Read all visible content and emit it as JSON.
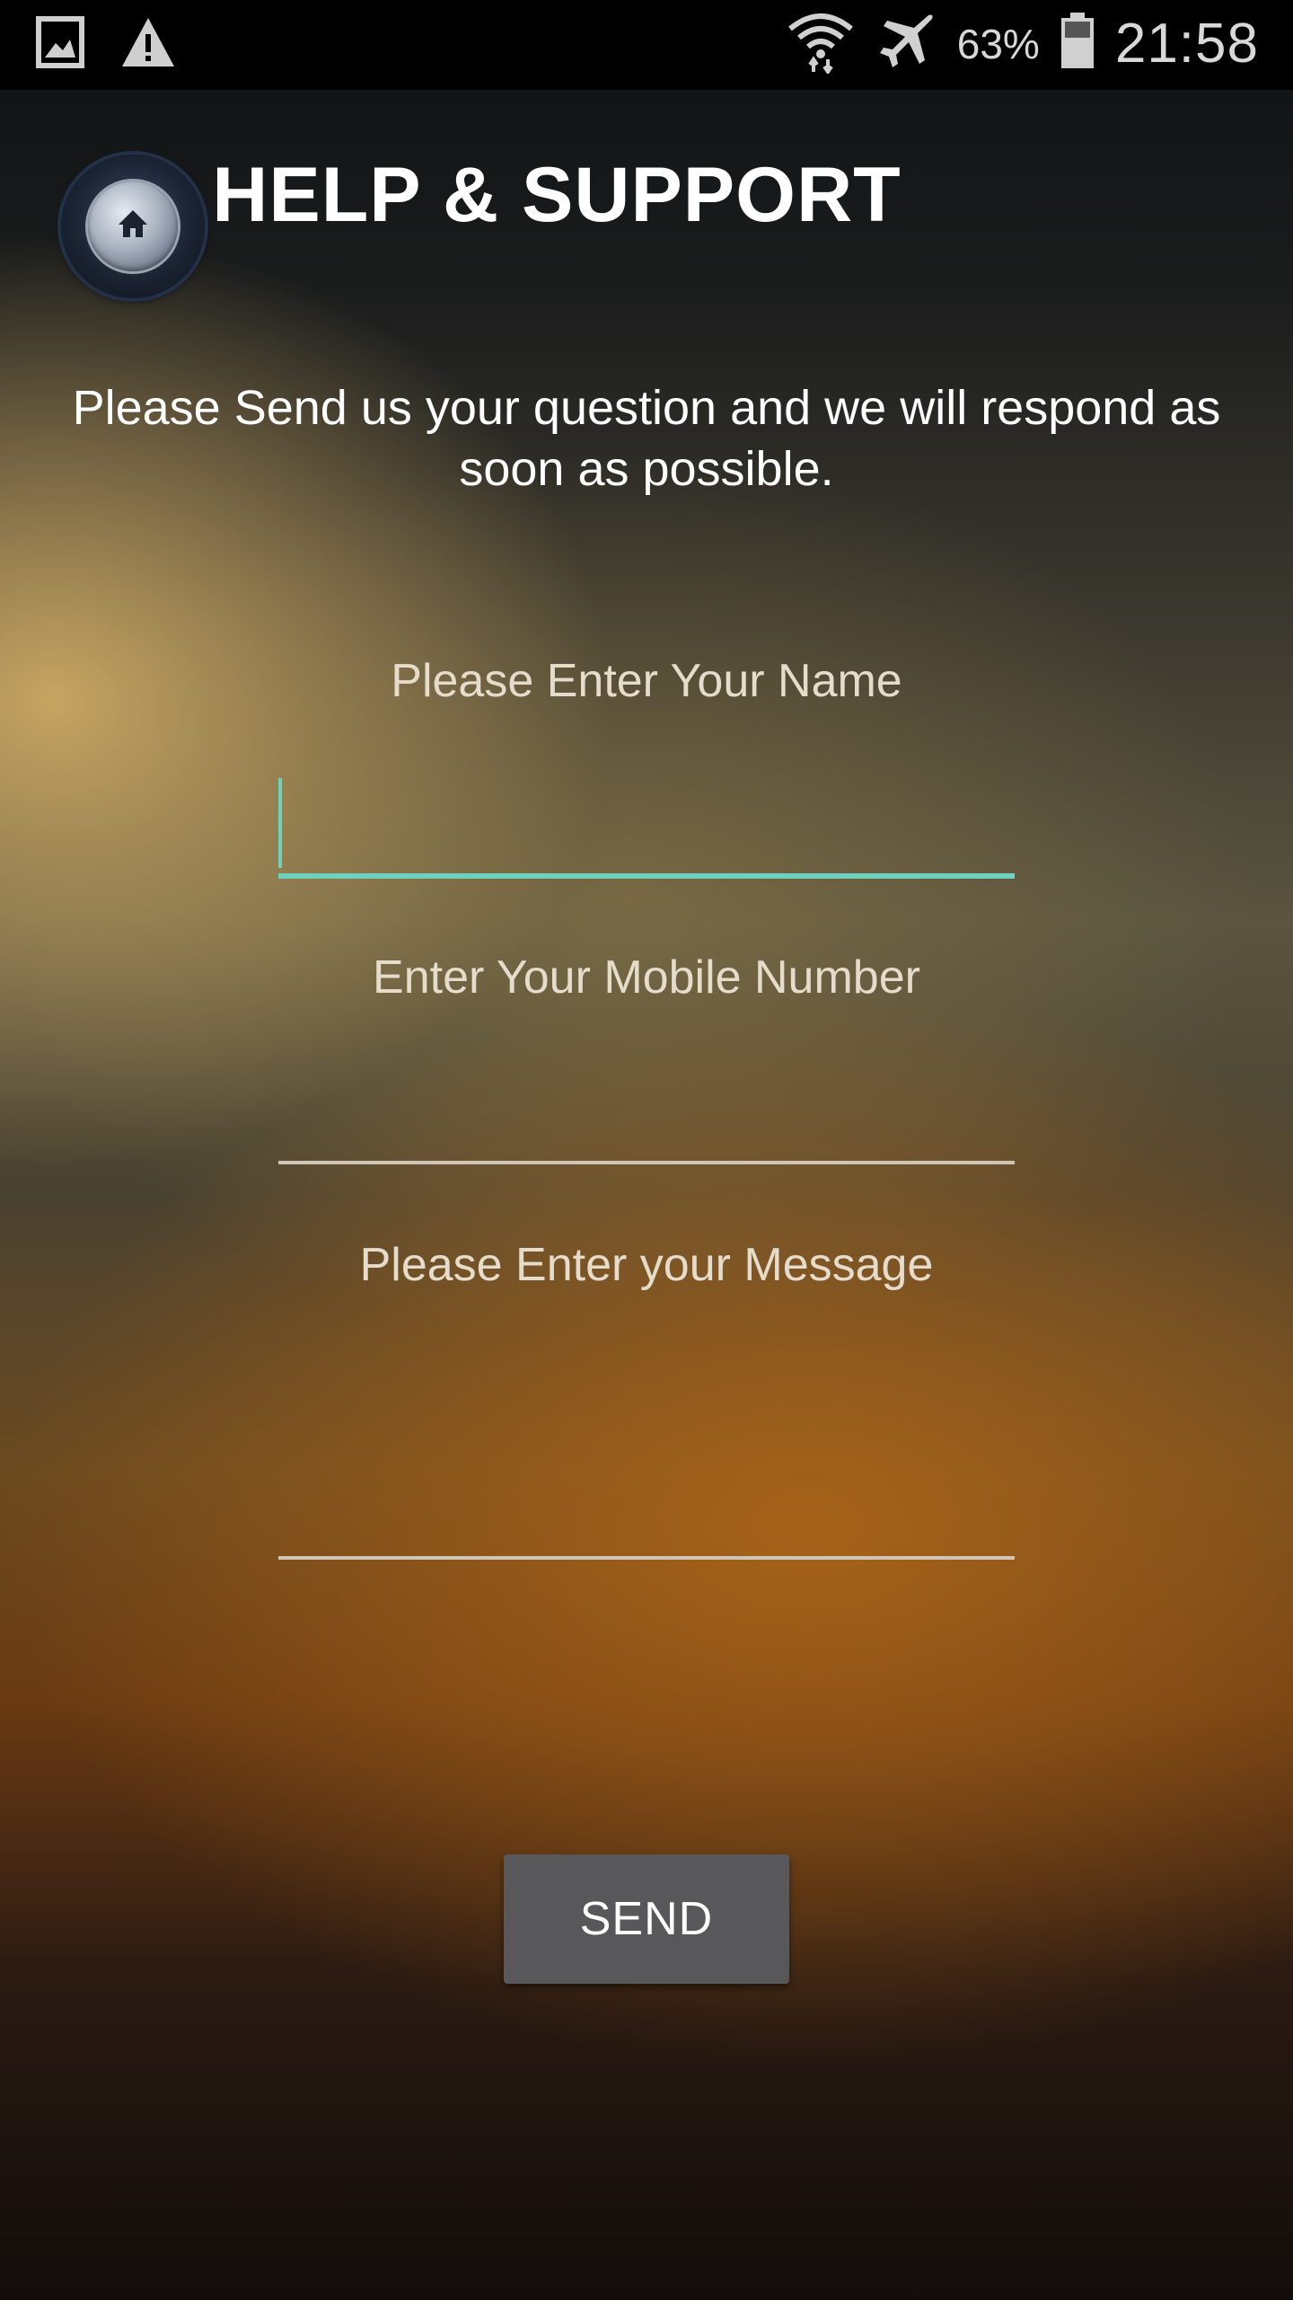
{
  "status_bar": {
    "left_icons": [
      "gallery-icon",
      "warning-icon"
    ],
    "right_icons": [
      "wifi-icon",
      "airplane-mode-icon",
      "battery-icon"
    ],
    "battery_percent": "63%",
    "time": "21:58"
  },
  "header": {
    "home_icon": "home-icon",
    "title": "HELP & SUPPORT"
  },
  "intro": {
    "text": "Please Send us your question and we will respond as soon as possible."
  },
  "form": {
    "name": {
      "label": "Please Enter Your Name",
      "value": ""
    },
    "mobile": {
      "label": "Enter Your Mobile Number",
      "value": ""
    },
    "message": {
      "label": "Please Enter your Message",
      "value": ""
    },
    "send_label": "SEND"
  },
  "colors": {
    "accent": "#6fd0bd",
    "button_bg": "#58585a",
    "status_bar_bg": "#000000"
  }
}
